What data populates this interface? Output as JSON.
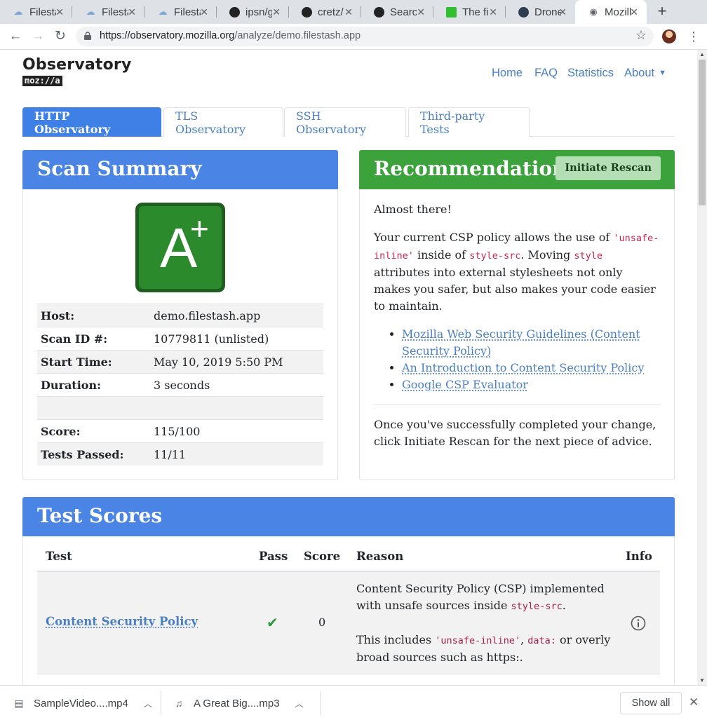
{
  "browser": {
    "tabs": [
      {
        "label": "Filestash",
        "icon": "cloud-icon"
      },
      {
        "label": "Filestash",
        "icon": "cloud-icon"
      },
      {
        "label": "Filestash",
        "icon": "cloud-icon"
      },
      {
        "label": "ipsn/go-",
        "icon": "github-icon"
      },
      {
        "label": "cretz/",
        "icon": "github-icon"
      },
      {
        "label": "Search",
        "icon": "github-icon"
      },
      {
        "label": "The fi",
        "icon": "monster-icon"
      },
      {
        "label": "Drone",
        "icon": "drone-icon"
      },
      {
        "label": "Mozilla",
        "icon": "globe-icon"
      }
    ],
    "url_host": "https://observatory.mozilla.org",
    "url_path": "/analyze/demo.filestash.app"
  },
  "site": {
    "logo_title": "Observatory",
    "logo_sub": "moz://a",
    "nav": [
      "Home",
      "FAQ",
      "Statistics",
      "About"
    ]
  },
  "obs_tabs": [
    "HTTP Observatory",
    "TLS Observatory",
    "SSH Observatory",
    "Third-party Tests"
  ],
  "summary": {
    "title": "Scan Summary",
    "grade_letter": "A",
    "grade_modifier": "+",
    "rows": [
      {
        "k": "Host:",
        "v": "demo.filestash.app"
      },
      {
        "k": "Scan ID #:",
        "v": "10779811 (unlisted)"
      },
      {
        "k": "Start Time:",
        "v": "May 10, 2019 5:50 PM"
      },
      {
        "k": "Duration:",
        "v": "3 seconds"
      },
      {
        "k": "",
        "v": ""
      },
      {
        "k": "Score:",
        "v": "115/100"
      },
      {
        "k": "Tests Passed:",
        "v": "11/11"
      }
    ]
  },
  "recommendation": {
    "title": "Recommendation",
    "rescan_label": "Initiate Rescan",
    "intro": "Almost there!",
    "p1_a": "Your current CSP policy allows the use of ",
    "p1_code1": "'unsafe-inline'",
    "p1_b": " inside of ",
    "p1_code2": "style-src",
    "p1_c": ". Moving ",
    "p1_code3": "style",
    "p1_d": " attributes into external stylesheets not only makes you safer, but also makes your code easier to maintain.",
    "links": [
      "Mozilla Web Security Guidelines (Content Security Policy)",
      "An Introduction to Content Security Policy",
      "Google CSP Evaluator"
    ],
    "outro": "Once you've successfully completed your change, click Initiate Rescan for the next piece of advice."
  },
  "scores": {
    "title": "Test Scores",
    "headers": [
      "Test",
      "Pass",
      "Score",
      "Reason",
      "Info"
    ],
    "rows": [
      {
        "test": "Content Security Policy",
        "pass": "✔",
        "score": "0",
        "reason_a": "Content Security Policy (CSP) implemented with unsafe sources inside ",
        "reason_code": "style-src",
        "reason_b": ".",
        "reason2_a": "This includes ",
        "reason2_code1": "'unsafe-inline'",
        "reason2_sep": ", ",
        "reason2_code2": "data:",
        "reason2_b": " or overly broad sources such as https:."
      }
    ]
  },
  "downloads": {
    "items": [
      {
        "name": "SampleVideo....mp4"
      },
      {
        "name": "A Great Big....mp3"
      }
    ],
    "show_all": "Show all"
  },
  "colors": {
    "primary_blue": "#4a85e6",
    "success_green": "#3ca23c",
    "grade_green": "#2b8a2b",
    "link": "#4a7fc1",
    "code_pink": "#c7254e"
  }
}
